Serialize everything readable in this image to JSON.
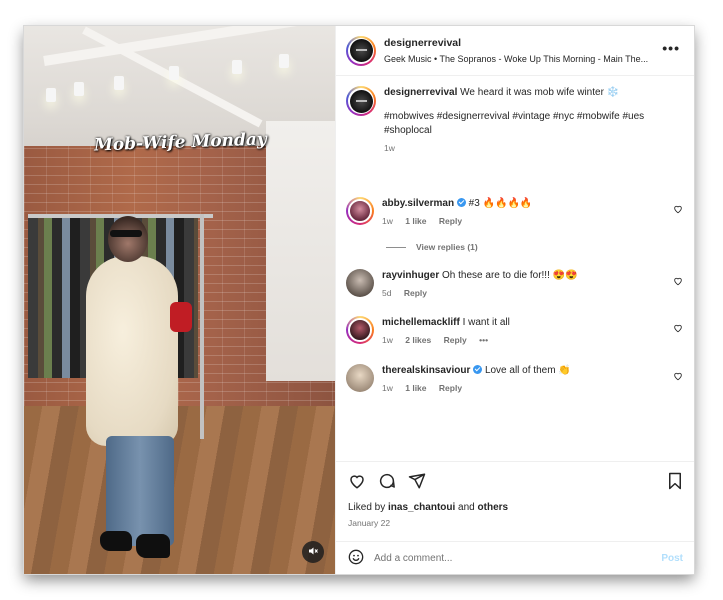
{
  "post": {
    "username": "designerrevival",
    "music": "Geek Music • The Sopranos - Woke Up This Morning - Main The...",
    "overlay_text": "Mob-Wife Monday",
    "caption_text": "We heard it was mob wife winter ❄️",
    "hashtags": "#mobwives #designerrevival #vintage #nyc #mobwife #ues #shoplocal",
    "caption_age": "1w",
    "more_label": "•••"
  },
  "comments": [
    {
      "username": "abby.silverman",
      "verified": true,
      "text": "#3 🔥🔥🔥🔥",
      "age": "1w",
      "likes": "1 like",
      "reply": "Reply"
    },
    {
      "username": "rayvinhuger",
      "verified": false,
      "text": "Oh these are to die for!!! 😍😍",
      "age": "5d",
      "likes": "",
      "reply": "Reply"
    },
    {
      "username": "michellemackliff",
      "verified": false,
      "text": "I want it all",
      "age": "1w",
      "likes": "2 likes",
      "reply": "Reply",
      "more": "•••"
    },
    {
      "username": "therealskinsaviour",
      "verified": true,
      "text": "Love all of them 👏",
      "age": "1w",
      "likes": "1 like",
      "reply": "Reply"
    }
  ],
  "view_replies": "View replies (1)",
  "footer": {
    "liked_prefix": "Liked by ",
    "liked_user": "inas_chantoui",
    "liked_and": " and ",
    "liked_others": "others",
    "date": "January 22",
    "comment_placeholder": "Add a comment...",
    "post_label": "Post"
  },
  "icons": {
    "like": "heart-icon",
    "comment": "comment-icon",
    "share": "share-icon",
    "save": "bookmark-icon",
    "mute": "speaker-muted-icon"
  },
  "colors": {
    "link": "#00376b",
    "verified": "#3897f0",
    "post_disabled": "#b2dffc",
    "meta": "#737373"
  }
}
